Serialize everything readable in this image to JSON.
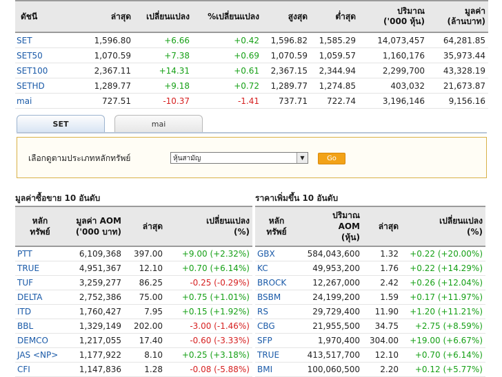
{
  "index_table": {
    "headers": [
      "ดัชนี",
      "ล่าสุด",
      "เปลี่ยนแปลง",
      "%เปลี่ยนแปลง",
      "สูงสุด",
      "ต่ำสุด",
      "ปริมาณ\n('000 หุ้น)",
      "มูลค่า\n(ล้านบาท)"
    ],
    "rows": [
      {
        "name": "SET",
        "last": "1,596.80",
        "chg": "+6.66",
        "pct": "+0.42",
        "high": "1,596.82",
        "low": "1,585.29",
        "vol": "14,073,457",
        "val": "64,281.85",
        "dir": "pos"
      },
      {
        "name": "SET50",
        "last": "1,070.59",
        "chg": "+7.38",
        "pct": "+0.69",
        "high": "1,070.59",
        "low": "1,059.57",
        "vol": "1,160,176",
        "val": "35,973.44",
        "dir": "pos"
      },
      {
        "name": "SET100",
        "last": "2,367.11",
        "chg": "+14.31",
        "pct": "+0.61",
        "high": "2,367.15",
        "low": "2,344.94",
        "vol": "2,299,700",
        "val": "43,328.19",
        "dir": "pos"
      },
      {
        "name": "SETHD",
        "last": "1,289.77",
        "chg": "+9.18",
        "pct": "+0.72",
        "high": "1,289.77",
        "low": "1,274.85",
        "vol": "403,032",
        "val": "21,673.87",
        "dir": "pos"
      },
      {
        "name": "mai",
        "last": "727.51",
        "chg": "-10.37",
        "pct": "-1.41",
        "high": "737.71",
        "low": "722.74",
        "vol": "3,196,146",
        "val": "9,156.16",
        "dir": "neg"
      }
    ]
  },
  "tabs": [
    {
      "label": "SET",
      "active": true
    },
    {
      "label": "mai",
      "active": false
    }
  ],
  "filter": {
    "label": "เลือกดูตามประเภทหลักทรัพย์",
    "selected": "หุ้นสามัญ",
    "go_label": "Go"
  },
  "left_section": {
    "title": "มูลค่าซื้อขาย 10 อันดับ",
    "headers": [
      "หลัก\nทรัพย์",
      "มูลค่า AOM\n('000 บาท)",
      "ล่าสุด",
      "เปลี่ยนแปลง\n(%)"
    ],
    "rows": [
      {
        "sym": "PTT",
        "val": "6,109,368",
        "last": "397.00",
        "chg": "+9.00 (+2.32%)",
        "dir": "pos"
      },
      {
        "sym": "TRUE",
        "val": "4,951,367",
        "last": "12.10",
        "chg": "+0.70 (+6.14%)",
        "dir": "pos"
      },
      {
        "sym": "TUF",
        "val": "3,259,277",
        "last": "86.25",
        "chg": "-0.25 (-0.29%)",
        "dir": "neg"
      },
      {
        "sym": "DELTA",
        "val": "2,752,386",
        "last": "75.00",
        "chg": "+0.75 (+1.01%)",
        "dir": "pos"
      },
      {
        "sym": "ITD",
        "val": "1,760,427",
        "last": "7.95",
        "chg": "+0.15 (+1.92%)",
        "dir": "pos"
      },
      {
        "sym": "BBL",
        "val": "1,329,149",
        "last": "202.00",
        "chg": "-3.00 (-1.46%)",
        "dir": "neg"
      },
      {
        "sym": "DEMCO",
        "val": "1,217,055",
        "last": "17.40",
        "chg": "-0.60 (-3.33%)",
        "dir": "neg"
      },
      {
        "sym": "JAS <NP>",
        "val": "1,177,922",
        "last": "8.10",
        "chg": "+0.25 (+3.18%)",
        "dir": "pos"
      },
      {
        "sym": "CFI",
        "val": "1,147,836",
        "last": "1.28",
        "chg": "-0.08 (-5.88%)",
        "dir": "neg"
      }
    ]
  },
  "right_section": {
    "title": "ราคาเพิ่มขึ้น 10 อันดับ",
    "headers": [
      "หลัก\nทรัพย์",
      "ปริมาณ\nAOM\n(หุ้น)",
      "ล่าสุด",
      "เปลี่ยนแปลง\n(%)"
    ],
    "rows": [
      {
        "sym": "GBX",
        "vol": "584,043,600",
        "last": "1.32",
        "chg": "+0.22 (+20.00%)",
        "dir": "pos"
      },
      {
        "sym": "KC",
        "vol": "49,953,200",
        "last": "1.76",
        "chg": "+0.22 (+14.29%)",
        "dir": "pos"
      },
      {
        "sym": "BROCK",
        "vol": "12,267,000",
        "last": "2.42",
        "chg": "+0.26 (+12.04%)",
        "dir": "pos"
      },
      {
        "sym": "BSBM",
        "vol": "24,199,200",
        "last": "1.59",
        "chg": "+0.17 (+11.97%)",
        "dir": "pos"
      },
      {
        "sym": "RS",
        "vol": "29,729,400",
        "last": "11.90",
        "chg": "+1.20 (+11.21%)",
        "dir": "pos"
      },
      {
        "sym": "CBG",
        "vol": "21,955,500",
        "last": "34.75",
        "chg": "+2.75 (+8.59%)",
        "dir": "pos"
      },
      {
        "sym": "SFP",
        "vol": "1,970,400",
        "last": "304.00",
        "chg": "+19.00 (+6.67%)",
        "dir": "pos"
      },
      {
        "sym": "TRUE",
        "vol": "413,517,700",
        "last": "12.10",
        "chg": "+0.70 (+6.14%)",
        "dir": "pos"
      },
      {
        "sym": "BMI",
        "vol": "100,060,500",
        "last": "2.20",
        "chg": "+0.12 (+5.77%)",
        "dir": "pos"
      }
    ]
  }
}
